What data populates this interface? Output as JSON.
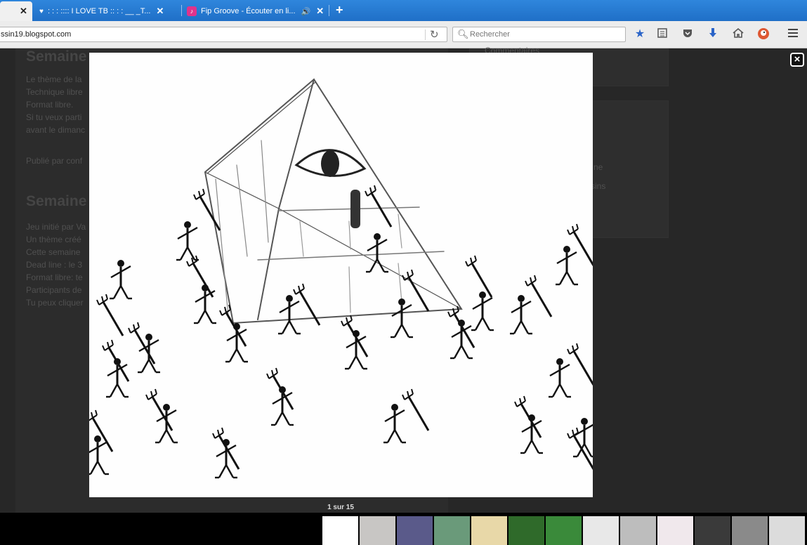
{
  "browser": {
    "tabs": [
      {
        "label": "",
        "active": true
      },
      {
        "label": ": : : :::: I LOVE TB :: : : __ _T...",
        "icon": "heart-icon"
      },
      {
        "label": "Fip Groove - Écouter en li...",
        "icon": "fip-icon",
        "audio": true
      }
    ],
    "url": "ssin19.blogspot.com",
    "search_placeholder": "Rechercher"
  },
  "blog": {
    "post1_title": "Semaine",
    "post1_lines": [
      "Le thème de la",
      "Technique libre",
      "Format libre.",
      "Si tu veux parti",
      "avant le dimanc"
    ],
    "post1_footer": "Publié par conf",
    "post2_title": "Semaine",
    "post2_lines": [
      "Jeu initié par Va",
      "Un thème créé",
      "Cette semaine",
      "Dead line : le 3",
      "Format libre: te",
      "Participants de",
      "Tu peux cliquer"
    ],
    "sidebar_top": "Commentaires",
    "sidebar_items": [
      "ne",
      "ssins"
    ]
  },
  "lightbox": {
    "counter": "1 sur 15",
    "close_symbol": "×",
    "thumbnail_count": 15,
    "thumb_colors": [
      "#ffffff",
      "#c8c6c4",
      "#5a5a8a",
      "#6a9a7a",
      "#e8d8a8",
      "#2f6a2a",
      "#3a8a3a",
      "#e8e8e8",
      "#bdbdbd",
      "#f0e8ec",
      "#3a3a3a",
      "#8a8a8a",
      "#dcdcdc"
    ]
  }
}
